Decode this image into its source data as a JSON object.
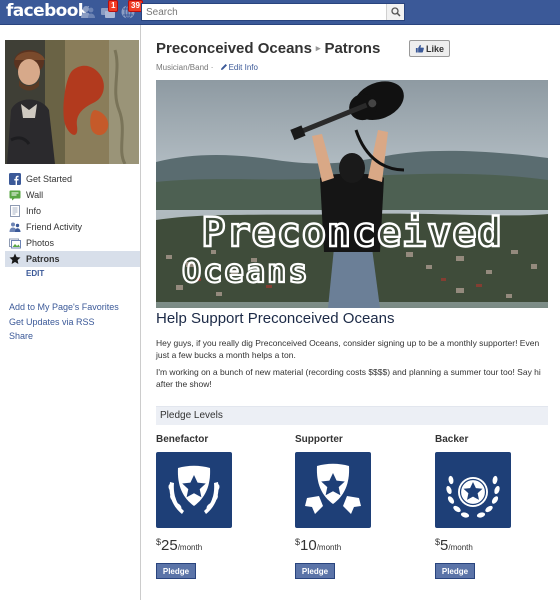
{
  "topbar": {
    "logo": "facebook",
    "search_placeholder": "Search",
    "friend_requests_badge": "",
    "messages_badge": "1",
    "notifications_badge": "39"
  },
  "sidebar": {
    "nav": [
      {
        "label": "Get Started",
        "icon": "facebook-icon"
      },
      {
        "label": "Wall",
        "icon": "wall-icon"
      },
      {
        "label": "Info",
        "icon": "info-icon"
      },
      {
        "label": "Friend Activity",
        "icon": "friends-icon"
      },
      {
        "label": "Photos",
        "icon": "photos-icon"
      },
      {
        "label": "Patrons",
        "icon": "star-icon",
        "active": true
      }
    ],
    "edit_label": "EDIT",
    "links": [
      "Add to My Page's Favorites",
      "Get Updates via RSS",
      "Share"
    ]
  },
  "header": {
    "page_name": "Preconceived Oceans",
    "separator": "▸",
    "tab_name": "Patrons",
    "like_label": "Like",
    "category": "Musician/Band ·",
    "edit_info": "Edit Info"
  },
  "banner": {
    "title_line1": "Preconceived",
    "title_line2": "Oceans"
  },
  "content": {
    "heading": "Help Support Preconceived Oceans",
    "paragraph1": "Hey guys, if you really dig Preconceived Oceans, consider signing up to be a monthly supporter! Even just a few bucks a month helps a ton.",
    "paragraph2": "I'm working on a bunch of new material (recording costs $$$$) and planning a summer tour too! Say hi after the show!",
    "pledge_levels_label": "Pledge Levels"
  },
  "tiers": [
    {
      "name": "Benefactor",
      "currency": "$",
      "amount": "25",
      "period": "/month",
      "button": "Pledge",
      "badge_icon": "shield-wreath-star-icon"
    },
    {
      "name": "Supporter",
      "currency": "$",
      "amount": "10",
      "period": "/month",
      "button": "Pledge",
      "badge_icon": "shield-ribbon-star-icon"
    },
    {
      "name": "Backer",
      "currency": "$",
      "amount": "5",
      "period": "/month",
      "button": "Pledge",
      "badge_icon": "wreath-star-icon"
    }
  ],
  "colors": {
    "brand": "#3b5998",
    "badge_bg": "#1e3f77",
    "active_nav": "#d8dfea",
    "pledge_header": "#eceff5",
    "pledge_button": "#5b74a8"
  }
}
